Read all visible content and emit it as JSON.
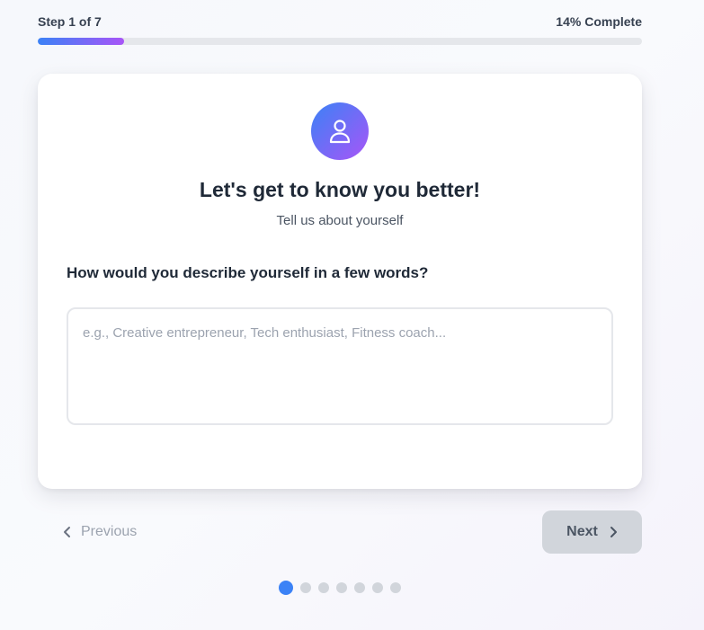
{
  "progress": {
    "step_label": "Step 1 of 7",
    "complete_label": "14% Complete",
    "fraction": 0.143
  },
  "card": {
    "icon": "user-icon",
    "title": "Let's get to know you better!",
    "subtitle": "Tell us about yourself",
    "question": "How would you describe yourself in a few words?",
    "answer": {
      "value": "",
      "placeholder": "e.g., Creative entrepreneur, Tech enthusiast, Fitness coach..."
    }
  },
  "navigation": {
    "previous_label": "Previous",
    "next_label": "Next",
    "previous_icon": "chevron-left-icon",
    "next_icon": "chevron-right-icon"
  },
  "steps": {
    "total": 7,
    "current": 1
  },
  "colors": {
    "accent_start": "#3b82f6",
    "accent_end": "#a855f7",
    "disabled_button": "#d1d5db",
    "inactive_dot": "#d1d5db"
  }
}
